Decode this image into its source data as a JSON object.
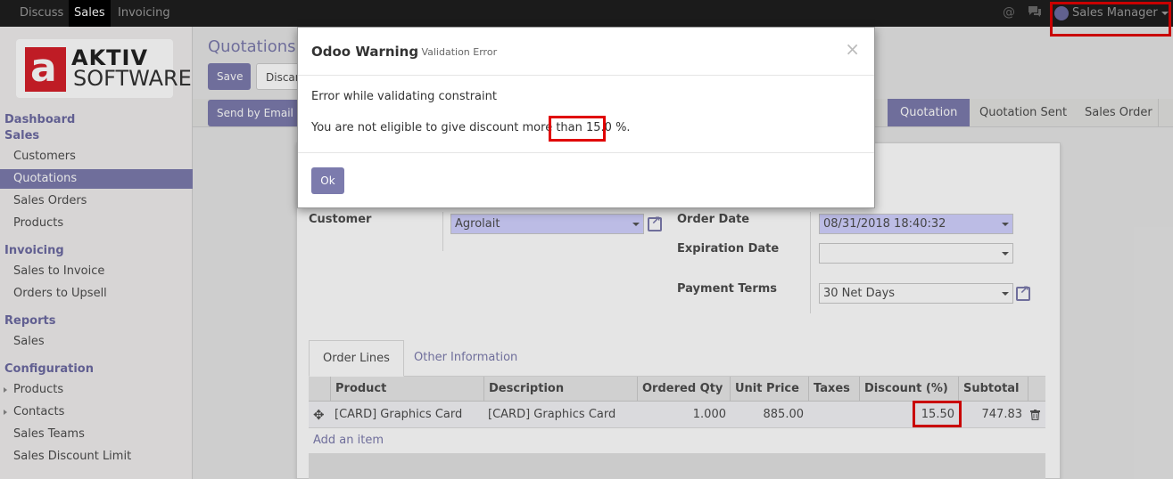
{
  "topbar": {
    "menus": [
      "Discuss",
      "Sales",
      "Invoicing"
    ],
    "active_menu": "Sales",
    "user_name": "Sales Manager"
  },
  "sidebar": {
    "logo": {
      "letter": "a",
      "line1": "AKTIV",
      "line2": "SOFTWARE"
    },
    "sections": [
      {
        "title": "Dashboard"
      },
      {
        "title": "Sales",
        "items": [
          "Customers",
          "Quotations",
          "Sales Orders",
          "Products"
        ]
      },
      {
        "title": "Invoicing",
        "items": [
          "Sales to Invoice",
          "Orders to Upsell"
        ]
      },
      {
        "title": "Reports",
        "items": [
          "Sales"
        ]
      },
      {
        "title": "Configuration",
        "items": [
          "Products",
          "Contacts",
          "Sales Teams",
          "Sales Discount Limit"
        ]
      }
    ],
    "active_item": "Quotations"
  },
  "main": {
    "breadcrumb": "Quotations /",
    "save_label": "Save",
    "discard_label": "Discard",
    "send_email_label": "Send by Email",
    "stages": [
      "Quotation",
      "Quotation Sent",
      "Sales Order"
    ],
    "current_stage": "Quotation"
  },
  "form": {
    "customer_label": "Customer",
    "customer_value": "Agrolait",
    "order_date_label": "Order Date",
    "order_date_value": "08/31/2018 18:40:32",
    "expiration_label": "Expiration Date",
    "expiration_value": "",
    "payment_terms_label": "Payment Terms",
    "payment_terms_value": "30 Net Days"
  },
  "tabs": [
    "Order Lines",
    "Other Information"
  ],
  "order_lines": {
    "columns": [
      "Product",
      "Description",
      "Ordered Qty",
      "Unit Price",
      "Taxes",
      "Discount (%)",
      "Subtotal"
    ],
    "rows": [
      {
        "product": "[CARD] Graphics Card",
        "description": "[CARD] Graphics Card",
        "qty": "1.000",
        "unit_price": "885.00",
        "taxes": "",
        "discount": "15.50",
        "subtotal": "747.83"
      }
    ],
    "add_item": "Add an item"
  },
  "dialog": {
    "title": "Odoo Warning",
    "subtitle": "- Validation Error",
    "close": "×",
    "line1": "Error while validating constraint",
    "line2_prefix": "You are not eligible to give discount more than ",
    "line2_value": "15.0 %.",
    "ok_label": "Ok"
  },
  "colors": {
    "accent": "#7c7bad",
    "highlight_box": "#e00000"
  }
}
